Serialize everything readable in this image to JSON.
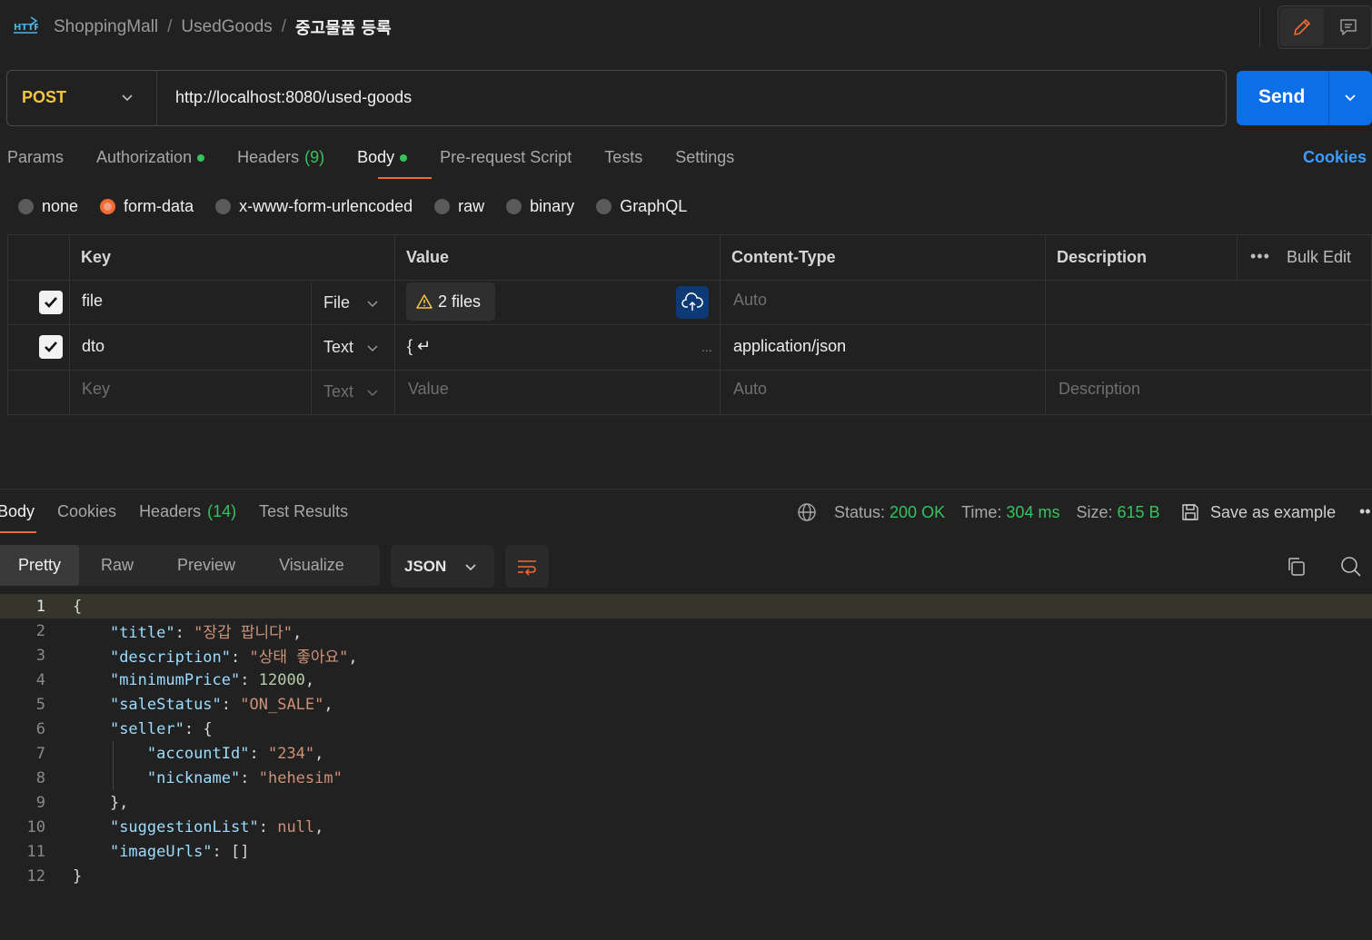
{
  "breadcrumb": {
    "icon_text": "HTTP",
    "items": [
      "ShoppingMall",
      "UsedGoods"
    ],
    "current": "중고물품 등록"
  },
  "request": {
    "method": "POST",
    "url": "http://localhost:8080/used-goods",
    "send_label": "Send"
  },
  "request_tabs": {
    "params": "Params",
    "authorization": "Authorization",
    "headers": "Headers",
    "headers_count": "(9)",
    "body": "Body",
    "pre_request": "Pre-request Script",
    "tests": "Tests",
    "settings": "Settings",
    "cookies": "Cookies"
  },
  "body_types": {
    "none": "none",
    "form_data": "form-data",
    "urlencoded": "x-www-form-urlencoded",
    "raw": "raw",
    "binary": "binary",
    "graphql": "GraphQL",
    "selected": "form-data"
  },
  "form_table": {
    "headers": {
      "key": "Key",
      "value": "Value",
      "content_type": "Content-Type",
      "description": "Description",
      "bulk_edit": "Bulk Edit"
    },
    "rows": [
      {
        "checked": true,
        "key": "file",
        "type": "File",
        "value": "2 files",
        "content_type": "Auto"
      },
      {
        "checked": true,
        "key": "dto",
        "type": "Text",
        "value": "{ ↵",
        "value_more": "...",
        "content_type": "application/json"
      }
    ],
    "new_row": {
      "key_placeholder": "Key",
      "type": "Text",
      "value_placeholder": "Value",
      "content_type_placeholder": "Auto",
      "description_placeholder": "Description"
    }
  },
  "response": {
    "tabs": {
      "body": "Body",
      "cookies": "Cookies",
      "headers": "Headers",
      "headers_count": "(14)",
      "test_results": "Test Results"
    },
    "status_label": "Status:",
    "status_value": "200 OK",
    "time_label": "Time:",
    "time_value": "304 ms",
    "size_label": "Size:",
    "size_value": "615 B",
    "save_example": "Save as example",
    "view_tabs": {
      "pretty": "Pretty",
      "raw": "Raw",
      "preview": "Preview",
      "visualize": "Visualize"
    },
    "format": "JSON"
  },
  "code_lines": [
    "1",
    "2",
    "3",
    "4",
    "5",
    "6",
    "7",
    "8",
    "9",
    "10",
    "11",
    "12"
  ],
  "json_body": {
    "title_key": "\"title\"",
    "title_val": "\"장갑 팝니다\"",
    "description_key": "\"description\"",
    "description_val": "\"상태 좋아요\"",
    "minimumPrice_key": "\"minimumPrice\"",
    "minimumPrice_val": "12000",
    "saleStatus_key": "\"saleStatus\"",
    "saleStatus_val": "\"ON_SALE\"",
    "seller_key": "\"seller\"",
    "accountId_key": "\"accountId\"",
    "accountId_val": "\"234\"",
    "nickname_key": "\"nickname\"",
    "nickname_val": "\"hehesim\"",
    "suggestionList_key": "\"suggestionList\"",
    "suggestionList_val": "null",
    "imageUrls_key": "\"imageUrls\"",
    "imageUrls_val": "[]"
  },
  "colors": {
    "accent_orange": "#f06a32",
    "send_blue": "#0d6fe8",
    "method_yellow": "#f5c542",
    "status_green": "#36c35d",
    "link_blue": "#3e9cff"
  }
}
